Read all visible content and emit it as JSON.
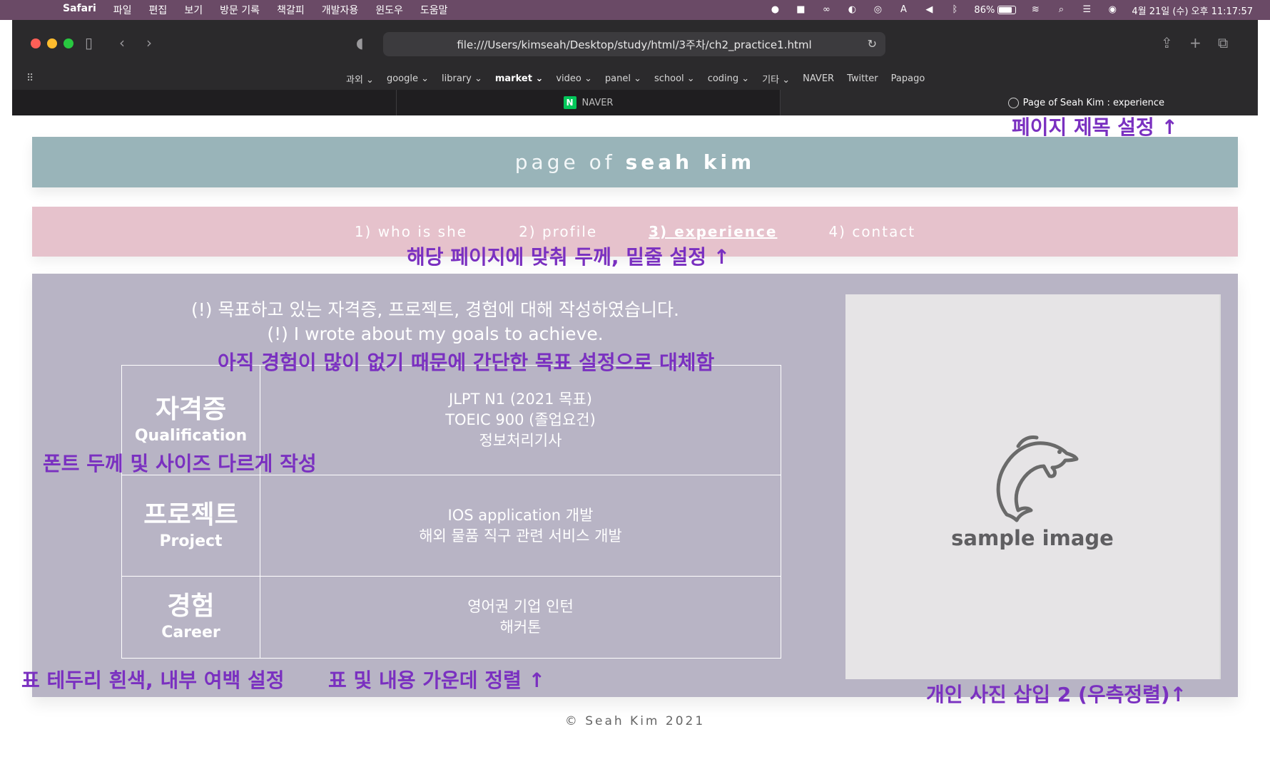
{
  "menubar": {
    "app_name": "Safari",
    "menus": [
      "파일",
      "편집",
      "보기",
      "방문 기록",
      "책갈피",
      "개발자용",
      "윈도우",
      "도움말"
    ],
    "battery_percent": "86%",
    "battery_level": 0.86,
    "clock": "4월 21일 (수) 오후  11:17:57"
  },
  "browser": {
    "url": "file:///Users/kimseah/Desktop/study/html/3주차/ch2_practice1.html",
    "bookmarks": [
      {
        "label": "과외 ⌄",
        "bold": false
      },
      {
        "label": "google ⌄",
        "bold": false
      },
      {
        "label": "library ⌄",
        "bold": false
      },
      {
        "label": "market ⌄",
        "bold": true
      },
      {
        "label": "video ⌄",
        "bold": false
      },
      {
        "label": "panel ⌄",
        "bold": false
      },
      {
        "label": "school ⌄",
        "bold": false
      },
      {
        "label": "coding ⌄",
        "bold": false
      },
      {
        "label": "기타 ⌄",
        "bold": false
      },
      {
        "label": "NAVER",
        "bold": false
      },
      {
        "label": "Twitter",
        "bold": false
      },
      {
        "label": "Papago",
        "bold": false
      }
    ],
    "tabs": [
      {
        "label": ""
      },
      {
        "label": "NAVER",
        "icon_letter": "N"
      },
      {
        "label": "Page of Seah Kim : experience"
      }
    ]
  },
  "page": {
    "header_prefix": "page  of",
    "header_name": "seah  kim",
    "nav": [
      {
        "label": "1) who is she",
        "current": false
      },
      {
        "label": "2) profile",
        "current": false
      },
      {
        "label": "3) experience",
        "current": true
      },
      {
        "label": "4) contact",
        "current": false
      }
    ],
    "intro_ko": "(!) 목표하고 있는 자격증, 프로젝트, 경험에 대해 작성하였습니다.",
    "intro_en": "(!) I wrote about my goals to achieve.",
    "table": [
      {
        "title_ko": "자격증",
        "title_en": "Qualification",
        "lines": [
          "JLPT N1 (2021 목표)",
          "TOEIC 900 (졸업요건)",
          "정보처리기사"
        ]
      },
      {
        "title_ko": "프로젝트",
        "title_en": "Project",
        "lines": [
          "IOS application 개발",
          "해외 물품 직구 관련 서비스 개발"
        ]
      },
      {
        "title_ko": "경험",
        "title_en": "Career",
        "lines": [
          "영어권 기업 인턴",
          "해커톤"
        ]
      }
    ],
    "photo_caption": "sample image",
    "footer": "© Seah Kim 2021"
  },
  "annotations": {
    "page_title": "페이지 제목 설정 ↑",
    "nav_style": "해당 페이지에 맞춰 두께, 밑줄 설정 ↑",
    "simple_goals": "아직 경험이 많이 없기 때문에 간단한 목표 설정으로 대체함",
    "font_weight": "폰트 두께 및 사이즈 다르게 작성",
    "table_border": "표 테두리 흰색, 내부 여백 설정",
    "table_center": "표 및 내용 가운데 정렬 ↑",
    "photo_insert": "개인 사진 삽입 2 (우측정렬)↑"
  },
  "colors": {
    "menubar": "#6a4a66",
    "header": "#99b4b9",
    "nav": "#e6c2cc",
    "panel": "#b8b4c5",
    "annotation": "#7a30c0"
  }
}
